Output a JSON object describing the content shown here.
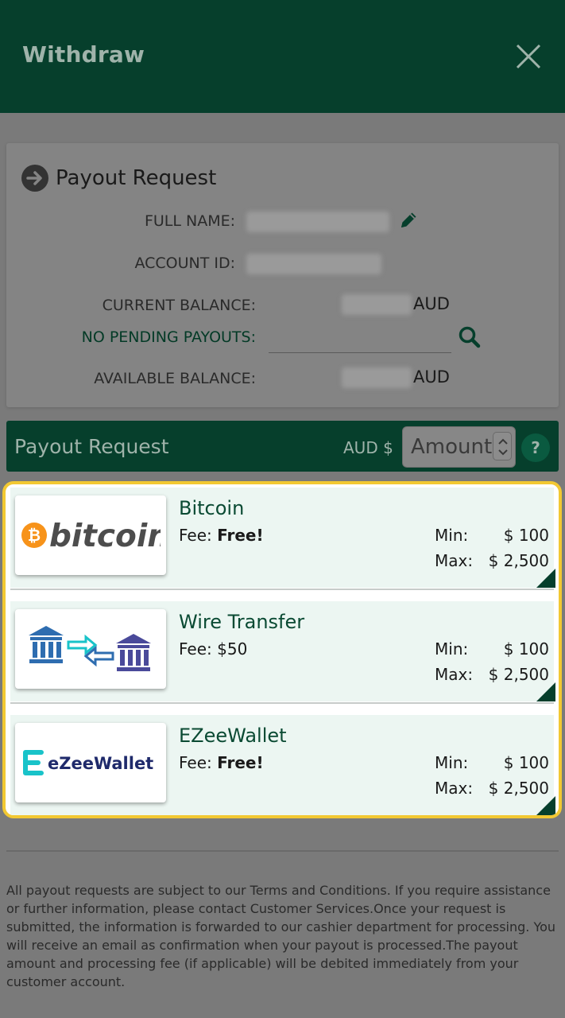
{
  "header": {
    "title": "Withdraw"
  },
  "info": {
    "title": "Payout Request",
    "full_name_label": "FULL NAME:",
    "account_id_label": "ACCOUNT ID:",
    "current_balance_label": "CURRENT BALANCE:",
    "current_balance_currency": "AUD",
    "pending_label": "NO PENDING PAYOUTS:",
    "available_balance_label": "AVAILABLE BALANCE:",
    "available_balance_currency": "AUD"
  },
  "request_bar": {
    "title": "Payout Request",
    "currency": "AUD $",
    "amount_placeholder": "Amount",
    "help": "?"
  },
  "methods": [
    {
      "name": "Bitcoin",
      "fee_label": "Fee:",
      "fee_value": "Free!",
      "min_label": "Min:",
      "min_value": "$ 100",
      "max_label": "Max:",
      "max_value": "$ 2,500",
      "logo_text": "bitcoin"
    },
    {
      "name": "Wire Transfer",
      "fee_label": "Fee:",
      "fee_value": "$50",
      "min_label": "Min:",
      "min_value": "$ 100",
      "max_label": "Max:",
      "max_value": "$ 2,500"
    },
    {
      "name": "EZeeWallet",
      "fee_label": "Fee:",
      "fee_value": "Free!",
      "min_label": "Min:",
      "min_value": "$ 100",
      "max_label": "Max:",
      "max_value": "$ 2,500",
      "logo_text": "eZeeWallet"
    }
  ],
  "disclaimer": "All payout requests are subject to our Terms and Conditions. If you require assistance or further information, please contact Customer Services.Once your request is submitted, the information is forwarded to our cashier department for processing. You will receive an email as confirmation when your payout is processed.The payout amount and processing fee (if applicable) will be debited immediately from your customer account.",
  "colors": {
    "brand_dark": "#063f2c",
    "highlight": "#f2c832",
    "method_bg": "#ecf6f2",
    "bitcoin_orange": "#f7931a",
    "ezee_teal": "#19c3c9",
    "ezee_navy": "#1f2a6b",
    "bank_blue": "#2e6db0",
    "bank_purple": "#4a4a9a"
  },
  "icons": {
    "close": "close-icon",
    "arrow": "arrow-right-circle-icon",
    "edit": "pencil-icon",
    "search": "search-icon"
  }
}
